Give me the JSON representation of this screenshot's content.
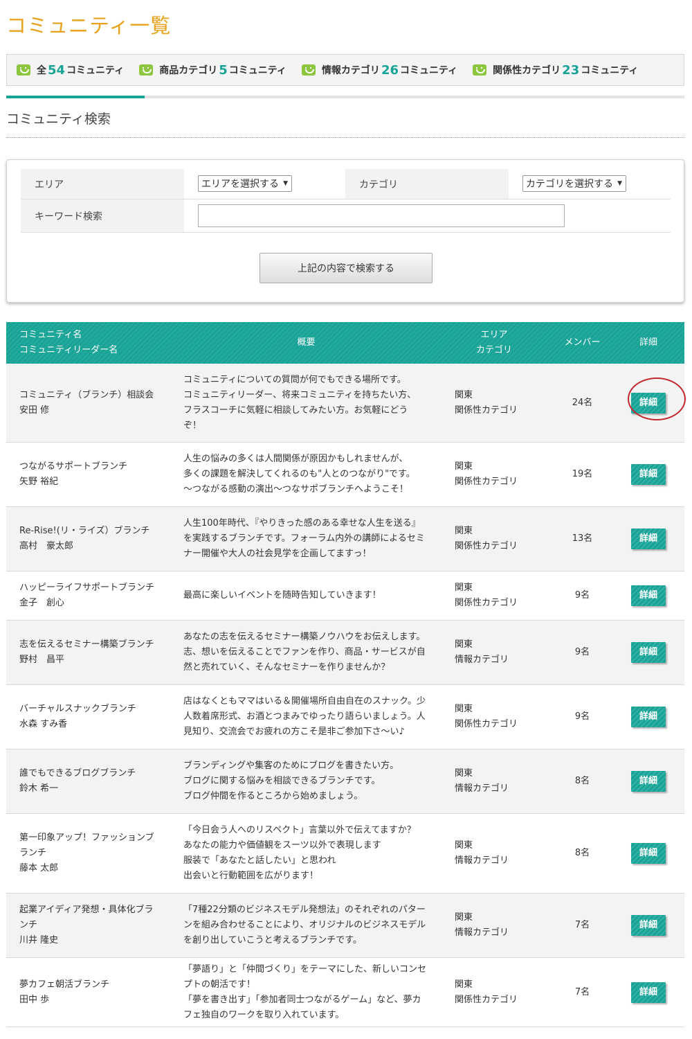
{
  "page_title": "コミュニティ一覧",
  "summary": [
    {
      "prefix": "全",
      "count": "54",
      "suffix": "コミュニティ"
    },
    {
      "prefix": "商品カテゴリ",
      "count": "5",
      "suffix": "コミュニティ"
    },
    {
      "prefix": "情報カテゴリ",
      "count": "26",
      "suffix": "コミュニティ"
    },
    {
      "prefix": "関係性カテゴリ",
      "count": "23",
      "suffix": "コミュニティ"
    }
  ],
  "search": {
    "title": "コミュニティ検索",
    "area_label": "エリア",
    "area_select": "エリアを選択する",
    "category_label": "カテゴリ",
    "category_select": "カテゴリを選択する",
    "keyword_label": "キーワード検索",
    "keyword_value": "",
    "submit_label": "上記の内容で検索する"
  },
  "table": {
    "headers": {
      "name_line1": "コミュニティ名",
      "name_line2": "コミュニティリーダー名",
      "desc": "概要",
      "area_line1": "エリア",
      "area_line2": "カテゴリ",
      "members": "メンバー",
      "detail": "詳細"
    },
    "detail_label": "詳細",
    "rows": [
      {
        "name": "コミュニティ（ブランチ）相談会",
        "leader": "安田 修",
        "desc": [
          "コミュニティについての質問が何でもできる場所です。",
          "コミュニティリーダー、将来コミュニティを持ちたい方、",
          "フラスコーチに気軽に相談してみたい方。お気軽にどう",
          "ぞ！"
        ],
        "area": "関東",
        "category": "関係性カテゴリ",
        "members": "24名"
      },
      {
        "name": "つながるサポートブランチ",
        "leader": "矢野 裕紀",
        "desc": [
          "人生の悩みの多くは人間関係が原因かもしれませんが、",
          "多くの課題を解決してくれるのも\"人とのつながり\"です。",
          "～つながる感動の演出～つなサポブランチへようこそ！"
        ],
        "area": "関東",
        "category": "関係性カテゴリ",
        "members": "19名"
      },
      {
        "name": "Re-Rise!(リ・ライズ）ブランチ",
        "leader": "高村　豪太郎",
        "desc": [
          "人生100年時代、『やりきった感のある幸せな人生を送る』",
          "を実践するブランチです。フォーラム内外の講師によるセミ",
          "ナー開催や大人の社会見学を企画してますっ！"
        ],
        "area": "関東",
        "category": "関係性カテゴリ",
        "members": "13名"
      },
      {
        "name": "ハッピーライフサポートブランチ",
        "leader": "金子　創心",
        "desc": [
          "最高に楽しいイベントを随時告知していきます！"
        ],
        "area": "関東",
        "category": "関係性カテゴリ",
        "members": "9名"
      },
      {
        "name": "志を伝えるセミナー構築ブランチ",
        "leader": "野村　昌平",
        "desc": [
          "あなたの志を伝えるセミナー構築ノウハウをお伝えします。",
          "志、想いを伝えることでファンを作り、商品・サービスが自",
          "然と売れていく、そんなセミナーを作りませんか？"
        ],
        "area": "関東",
        "category": "情報カテゴリ",
        "members": "9名"
      },
      {
        "name": "バーチャルスナックブランチ",
        "leader": "水森 すみ香",
        "desc": [
          "店はなくともママはいる＆開催場所自由自在のスナック。少",
          "人数着席形式、お酒とつまみでゆったり語らいましょう。人",
          "見知り、交流会でお疲れの方こそ是非ご参加下さ〜い♪"
        ],
        "area": "関東",
        "category": "関係性カテゴリ",
        "members": "9名"
      },
      {
        "name": "誰でもできるブログブランチ",
        "leader": "鈴木 希一",
        "desc": [
          "ブランディングや集客のためにブログを書きたい方。",
          "ブログに関する悩みを相談できるブランチです。",
          "ブログ仲間を作るところから始めましょう。"
        ],
        "area": "関東",
        "category": "情報カテゴリ",
        "members": "8名"
      },
      {
        "name": "第一印象アップ！ファッションブ|ランチ",
        "leader": "藤本 太郎",
        "desc": [
          "「今日会う人へのリスペクト」言葉以外で伝えてますか？",
          "あなたの能力や価値観をスーツ以外で表現します",
          "服装で「あなたと話したい」と思われ",
          "出会いと行動範囲を広がります！"
        ],
        "area": "関東",
        "category": "情報カテゴリ",
        "members": "8名"
      },
      {
        "name": "起業アイディア発想・具体化ブラ|ンチ",
        "leader": "川井 隆史",
        "desc": [
          "「7種22分類のビジネスモデル発想法」のそれぞれのパター",
          "ンを組み合わせることにより、オリジナルのビジネスモデル",
          "を創り出していこうと考えるブランチです。"
        ],
        "area": "関東",
        "category": "情報カテゴリ",
        "members": "7名"
      },
      {
        "name": "夢カフェ朝活ブランチ",
        "leader": "田中 歩",
        "desc": [
          "「夢語り」と「仲間づくり」をテーマにした、新しいコンセ",
          "プトの朝活です！",
          "「夢を書き出す」「参加者同士つながるゲーム」など、夢カ",
          "フェ独自のワークを取り入れています。"
        ],
        "area": "関東",
        "category": "関係性カテゴリ",
        "members": "7名"
      }
    ]
  },
  "colors": {
    "title_orange": "#e8a21c",
    "teal": "#18a397",
    "smile_green": "#8cc63f",
    "highlight_red": "#c0262c"
  }
}
